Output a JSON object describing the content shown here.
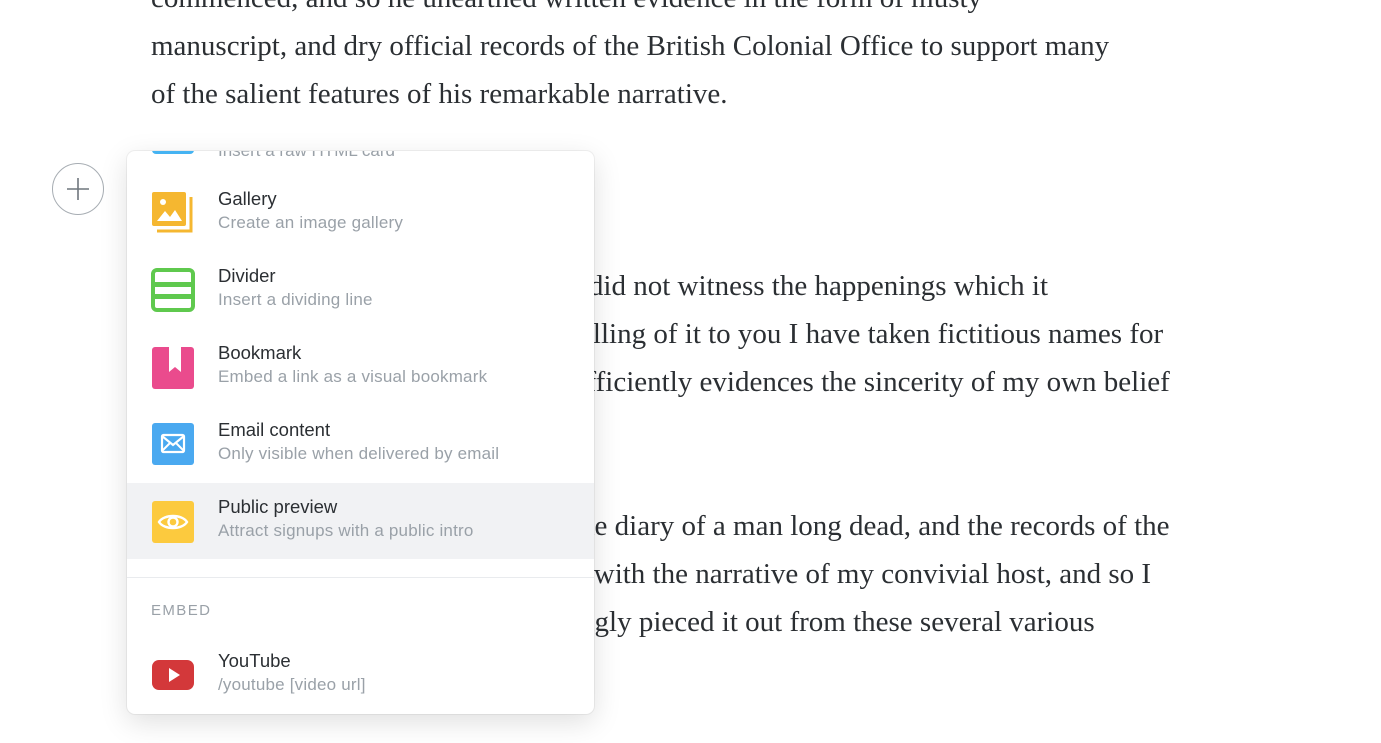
{
  "editor": {
    "para1": [
      "commenced, and so he unearthed written evidence in the form of musty",
      "manuscript, and dry official records of the British Colonial Office to support many",
      "of the salient features of his remarkable narrative."
    ],
    "para2": [
      "I did not witness the happenings which it",
      "telling of it to you I have taken fictitious names for",
      "ufficiently evidences the sincerity of my own belief"
    ],
    "para3": [
      "the diary of a man long dead, and the records of the",
      "n with the narrative of my convivial host, and so I",
      "ingly pieced it out from these several various"
    ]
  },
  "plus_button": {
    "icon": "plus-icon"
  },
  "card_menu": {
    "partial_item": {
      "desc": "Insert a raw HTML card"
    },
    "items": [
      {
        "title": "Gallery",
        "desc": "Create an image gallery",
        "icon": "gallery-icon",
        "color": "#f5b730"
      },
      {
        "title": "Divider",
        "desc": "Insert a dividing line",
        "icon": "divider-icon",
        "color": "#5fc94e"
      },
      {
        "title": "Bookmark",
        "desc": "Embed a link as a visual bookmark",
        "icon": "bookmark-icon",
        "color": "#ea4b8d"
      },
      {
        "title": "Email content",
        "desc": "Only visible when delivered by email",
        "icon": "email-icon",
        "color": "#4aa9f0"
      },
      {
        "title": "Public preview",
        "desc": "Attract signups with a public intro",
        "icon": "eye-icon",
        "color": "#fcca3e",
        "selected": true
      }
    ],
    "embed_section": {
      "label": "EMBED",
      "items": [
        {
          "title": "YouTube",
          "desc": "/youtube [video url]",
          "icon": "youtube-icon",
          "color": "#d3383a"
        }
      ]
    }
  }
}
